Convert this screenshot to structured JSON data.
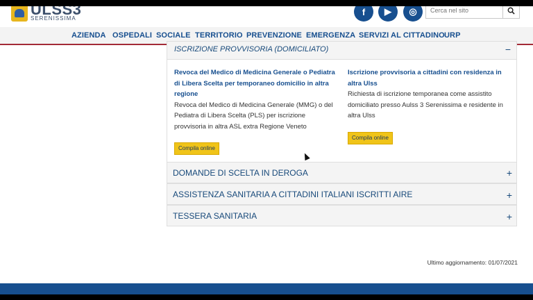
{
  "brand": {
    "logo_text": "ULSS3",
    "logo_sub": "SERENISSIMA"
  },
  "social": {
    "facebook": "f",
    "youtube": "▶",
    "instagram": "◎"
  },
  "search": {
    "placeholder": "Cerca nel sito"
  },
  "nav": {
    "items": [
      "AZIENDA",
      "OSPEDALI",
      "SOCIALE",
      "TERRITORIO",
      "PREVENZIONE",
      "EMERGENZA",
      "SERVIZI AL CITTADINO",
      "URP"
    ]
  },
  "open_section": {
    "title": "ISCRIZIONE PROVVISORIA (DOMICILIATO)",
    "toggle": "−",
    "cards": [
      {
        "title": "Revoca del Medico di Medicina Generale o Pediatra di Libera Scelta per temporaneo domicilio in altra regione",
        "description": "Revoca del Medico di Medicina Generale (MMG) o del Pediatra di Libera Scelta (PLS) per  iscrizione provvisoria in altra ASL extra Regione Veneto",
        "button": "Compila online"
      },
      {
        "title": "Iscrizione provvisoria a cittadini con residenza in altra Ulss",
        "description": "Richiesta di iscrizione temporanea come assistito domiciliato presso Aulss 3 Serenissima e residente in altra Ulss",
        "button": "Compila online"
      }
    ]
  },
  "accordion": [
    {
      "label": "DOMANDE DI SCELTA IN DEROGA",
      "toggle": "+"
    },
    {
      "label": "ASSISTENZA SANITARIA A CITTADINI ITALIANI ISCRITTI AIRE",
      "toggle": "+"
    },
    {
      "label": "TESSERA SANITARIA",
      "toggle": "+"
    }
  ],
  "last_update": "Ultimo aggiornamento: 01/07/2021",
  "colors": {
    "brand_blue": "#174f8f",
    "nav_border": "#a32a36",
    "button_yellow": "#f0c419"
  }
}
